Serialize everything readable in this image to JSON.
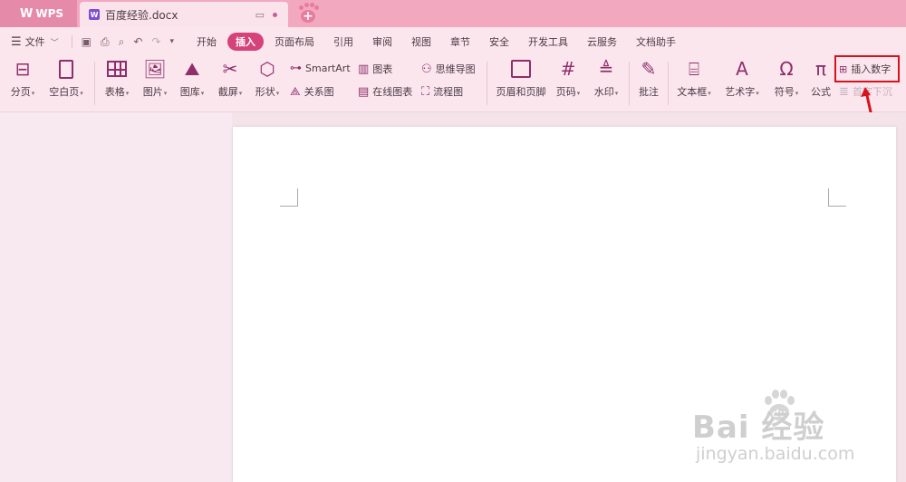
{
  "titlebar": {
    "app_tab": "WPS",
    "doc_tab": "百度经验.docx",
    "new_tab": "+"
  },
  "menu": {
    "file": "文件",
    "tabs": [
      {
        "label": "开始",
        "active": false
      },
      {
        "label": "插入",
        "active": true
      },
      {
        "label": "页面布局",
        "active": false
      },
      {
        "label": "引用",
        "active": false
      },
      {
        "label": "审阅",
        "active": false
      },
      {
        "label": "视图",
        "active": false
      },
      {
        "label": "章节",
        "active": false
      },
      {
        "label": "安全",
        "active": false
      },
      {
        "label": "开发工具",
        "active": false
      },
      {
        "label": "云服务",
        "active": false
      },
      {
        "label": "文档助手",
        "active": false
      }
    ]
  },
  "ribbon": {
    "page_break": "分页",
    "blank_page": "空白页",
    "table": "表格",
    "picture": "图片",
    "gallery": "图库",
    "screenshot": "截屏",
    "shape": "形状",
    "smartart": "SmartArt",
    "relation_chart": "关系图",
    "chart": "图表",
    "online_chart": "在线图表",
    "mindmap": "思维导图",
    "flowchart": "流程图",
    "header_footer": "页眉和页脚",
    "page_number": "页码",
    "watermark": "水印",
    "comment": "批注",
    "textbox": "文本框",
    "wordart": "艺术字",
    "symbol": "符号",
    "formula": "公式",
    "insert_number": "插入数字",
    "drop_cap": "首字下沉"
  },
  "watermark_overlay": {
    "brand": "Bai  经验",
    "url": "jingyan.baidu.com"
  },
  "colors": {
    "accent": "#d6427a",
    "icon": "#8e2f6b",
    "highlight": "#d8121c"
  }
}
